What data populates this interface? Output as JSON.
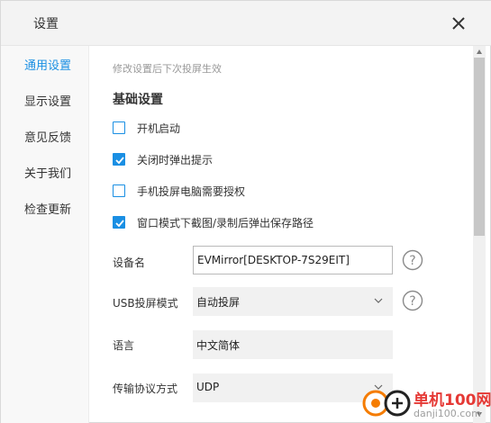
{
  "window": {
    "title": "设置",
    "close_icon": "close-icon"
  },
  "sidebar": {
    "items": [
      {
        "label": "通用设置",
        "active": true
      },
      {
        "label": "显示设置",
        "active": false
      },
      {
        "label": "意见反馈",
        "active": false
      },
      {
        "label": "关于我们",
        "active": false
      },
      {
        "label": "检查更新",
        "active": false
      }
    ]
  },
  "content": {
    "hint": "修改设置后下次投屏生效",
    "section_title": "基础设置",
    "checkboxes": [
      {
        "label": "开机启动",
        "checked": false
      },
      {
        "label": "关闭时弹出提示",
        "checked": true
      },
      {
        "label": "手机投屏电脑需要授权",
        "checked": false
      },
      {
        "label": "窗口模式下截图/录制后弹出保存路径",
        "checked": true
      }
    ],
    "fields": {
      "device_name": {
        "label": "设备名",
        "value": "EVMirror[DESKTOP-7S29EIT]"
      },
      "usb_mode": {
        "label": "USB投屏模式",
        "value": "自动投屏"
      },
      "language": {
        "label": "语言",
        "value": "中文简体"
      },
      "protocol": {
        "label": "传输协议方式",
        "value": "UDP"
      }
    }
  },
  "colors": {
    "accent": "#1a8fe3",
    "titlebar": "#f3f3f3",
    "sidebar": "#f8f8f8"
  },
  "watermark": {
    "logo_text": "单机100网",
    "url": "danji100.com"
  }
}
